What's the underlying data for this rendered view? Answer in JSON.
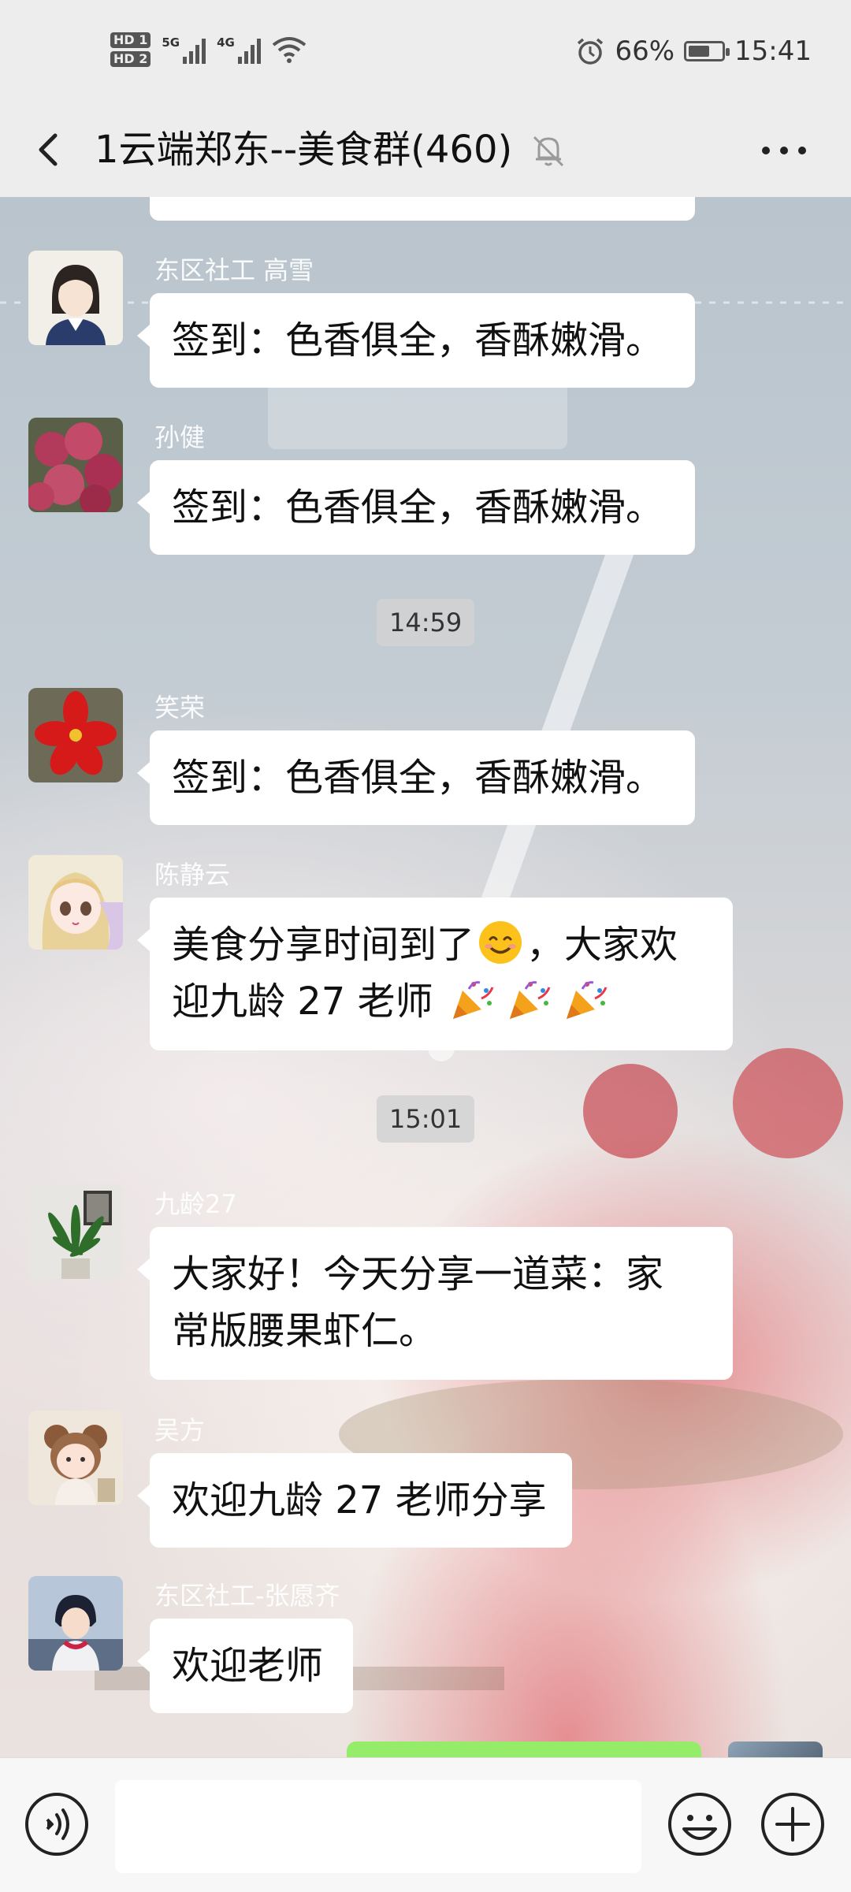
{
  "status_bar": {
    "hd1": "HD 1",
    "hd2": "HD 2",
    "net1": "5G",
    "net2": "4G",
    "battery_percent": "66%",
    "battery_level": 0.66,
    "time": "15:41",
    "icons": [
      "alarm-icon",
      "wifi-icon",
      "battery-icon",
      "signal-icon"
    ]
  },
  "header": {
    "title": "1云端郑东--美食群(460)",
    "icons": [
      "back-arrow-icon",
      "muted-bell-icon",
      "more-dots-icon"
    ]
  },
  "messages": [
    {
      "sender": "东区社工 高雪",
      "text": "签到：色香俱全，香酥嫩滑。"
    },
    {
      "sender": "孙健",
      "text": "签到：色香俱全，香酥嫩滑。"
    },
    {
      "timestamp": "14:59"
    },
    {
      "sender": "笑荣",
      "text": "签到：色香俱全，香酥嫩滑。"
    },
    {
      "sender": "陈静云",
      "text_line1_a": "美食分享时间到了",
      "text_line1_b": "，大家欢",
      "text_line2": "迎九龄 27 老师",
      "emojis": [
        "smile-emoji",
        "party-popper-emoji"
      ]
    },
    {
      "timestamp": "15:01"
    },
    {
      "sender": "九龄27",
      "text_line1": "大家好！今天分享一道菜：家",
      "text_line2": "常版腰果虾仁。"
    },
    {
      "sender": "吴方",
      "text": "欢迎九龄 27 老师分享"
    },
    {
      "sender": "东区社工-张愿齐",
      "text": "欢迎老师"
    }
  ],
  "input_bar": {
    "icons": [
      "voice-icon",
      "emoji-icon",
      "plus-icon"
    ]
  },
  "colors": {
    "background": "#ededed",
    "bubble": "#ffffff",
    "own_bubble": "#95ec69"
  }
}
